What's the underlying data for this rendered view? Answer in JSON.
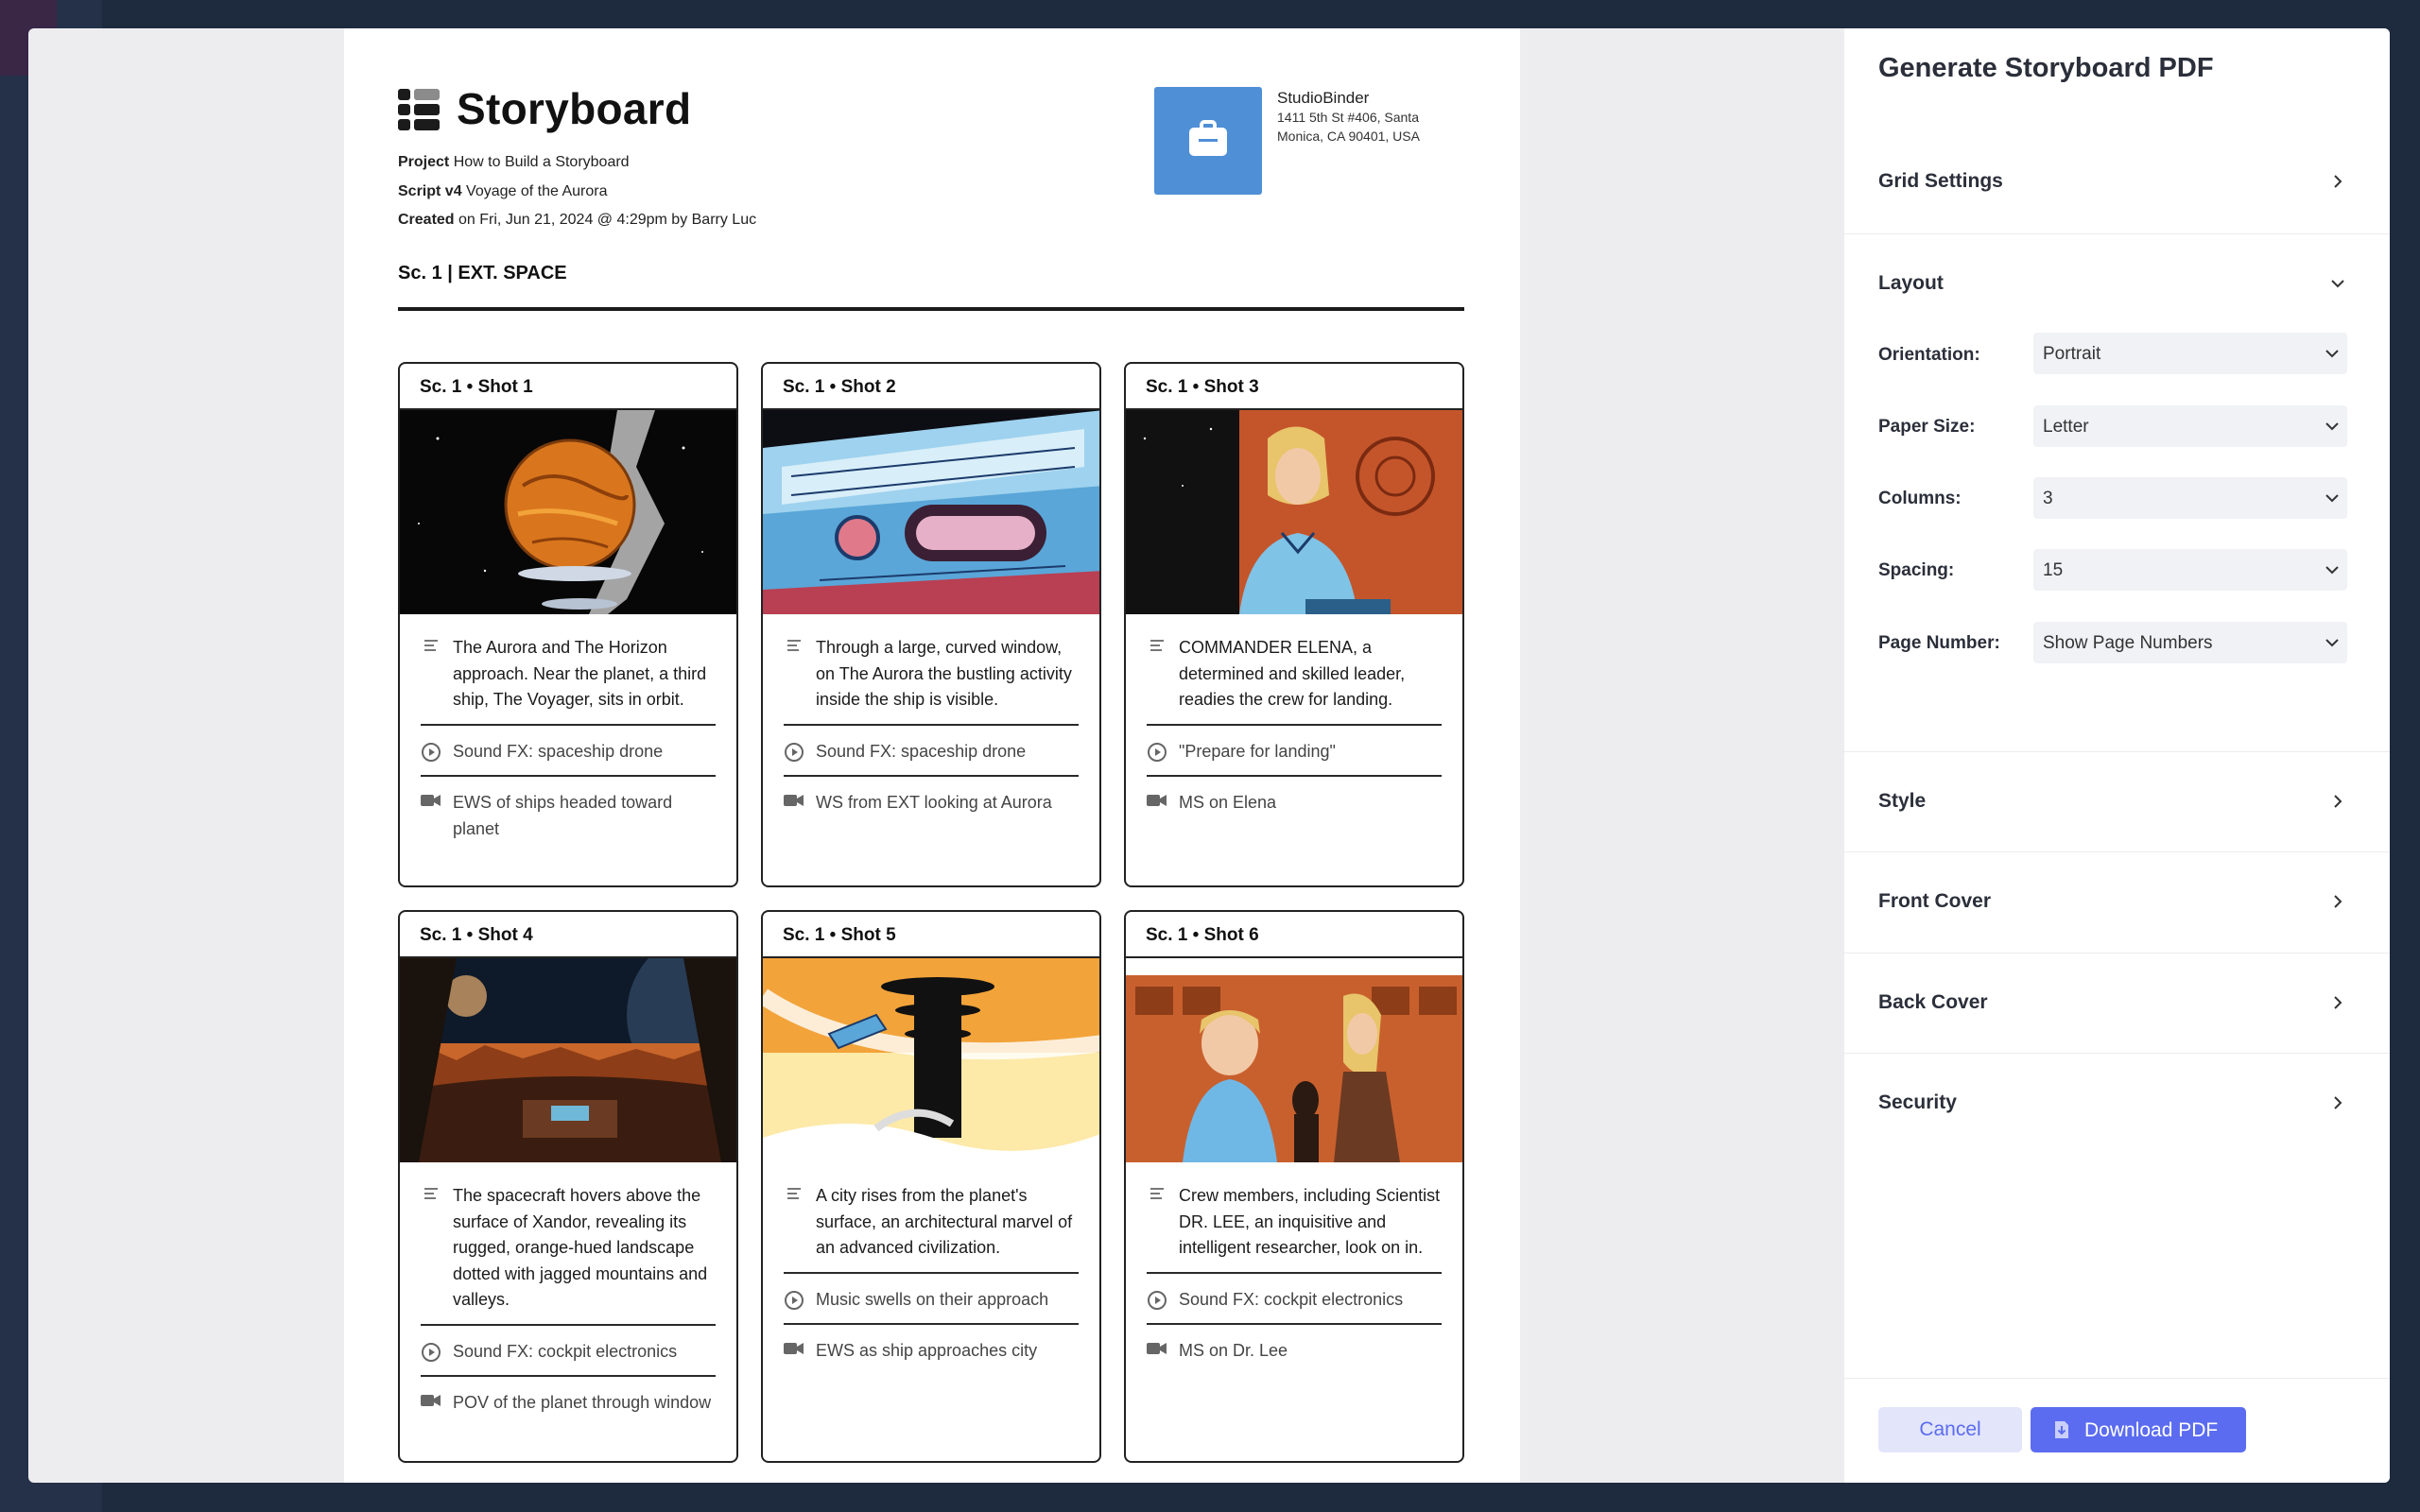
{
  "document": {
    "title": "Storyboard",
    "project_label": "Project",
    "project_value": "How to Build a Storyboard",
    "script_label": "Script v4",
    "script_value": "Voyage of the Aurora",
    "created_label": "Created",
    "created_value": "on Fri, Jun 21, 2024 @ 4:29pm by Barry Luc",
    "company_name": "StudioBinder",
    "company_address": "1411 5th St #406, Santa Monica, CA 90401, USA",
    "scene_heading": "Sc. 1 | EXT. SPACE"
  },
  "shots": [
    {
      "header": "Sc. 1  •  Shot  1",
      "description": "The Aurora and The Horizon approach. Near the planet, a third ship, The Voyager, sits in orbit.",
      "audio": "Sound FX: spaceship drone",
      "camera": "EWS of ships headed toward planet"
    },
    {
      "header": "Sc. 1  •  Shot  2",
      "description": "Through a large, curved window, on The Aurora the bustling activity inside the ship is visible.",
      "audio": "Sound FX: spaceship drone",
      "camera": "WS from EXT looking at Aurora"
    },
    {
      "header": "Sc. 1  •  Shot  3",
      "description": "COMMANDER ELENA, a determined and skilled leader, readies the crew for landing.",
      "audio": "\"Prepare for landing\"",
      "camera": "MS on Elena"
    },
    {
      "header": "Sc. 1  •  Shot  4",
      "description": "The spacecraft hovers above the surface of Xandor, revealing its rugged, orange-hued landscape dotted with jagged mountains and valleys.",
      "audio": "Sound FX: cockpit electronics",
      "camera": "POV of the planet through window"
    },
    {
      "header": "Sc. 1  •  Shot  5",
      "description": "A city rises from the planet's surface, an architectural marvel of an advanced civilization.",
      "audio": "Music swells on their approach",
      "camera": "EWS as ship approaches city"
    },
    {
      "header": "Sc. 1  •  Shot  6",
      "description": "Crew members, including Scientist DR. LEE, an inquisitive and intelligent researcher, look on in.",
      "audio": "Sound FX: cockpit electronics",
      "camera": "MS on Dr. Lee"
    }
  ],
  "panel": {
    "title": "Generate Storyboard PDF",
    "sections": {
      "grid_settings": "Grid Settings",
      "layout": "Layout",
      "style": "Style",
      "front_cover": "Front Cover",
      "back_cover": "Back Cover",
      "security": "Security"
    },
    "layout_fields": {
      "orientation_label": "Orientation:",
      "orientation_value": "Portrait",
      "paper_size_label": "Paper Size:",
      "paper_size_value": "Letter",
      "columns_label": "Columns:",
      "columns_value": "3",
      "spacing_label": "Spacing:",
      "spacing_value": "15",
      "page_number_label": "Page Number:",
      "page_number_value": "Show Page Numbers"
    },
    "cancel_label": "Cancel",
    "download_label": "Download PDF"
  },
  "colors": {
    "accent": "#5b6cf0",
    "cancel_bg": "#e3e5fb",
    "company_logo": "#4f8fd6"
  },
  "icons": [
    "grid-logo-icon",
    "briefcase-icon",
    "description-icon",
    "audio-play-icon",
    "camera-icon",
    "chevron-right-icon",
    "chevron-down-icon",
    "download-file-icon"
  ]
}
